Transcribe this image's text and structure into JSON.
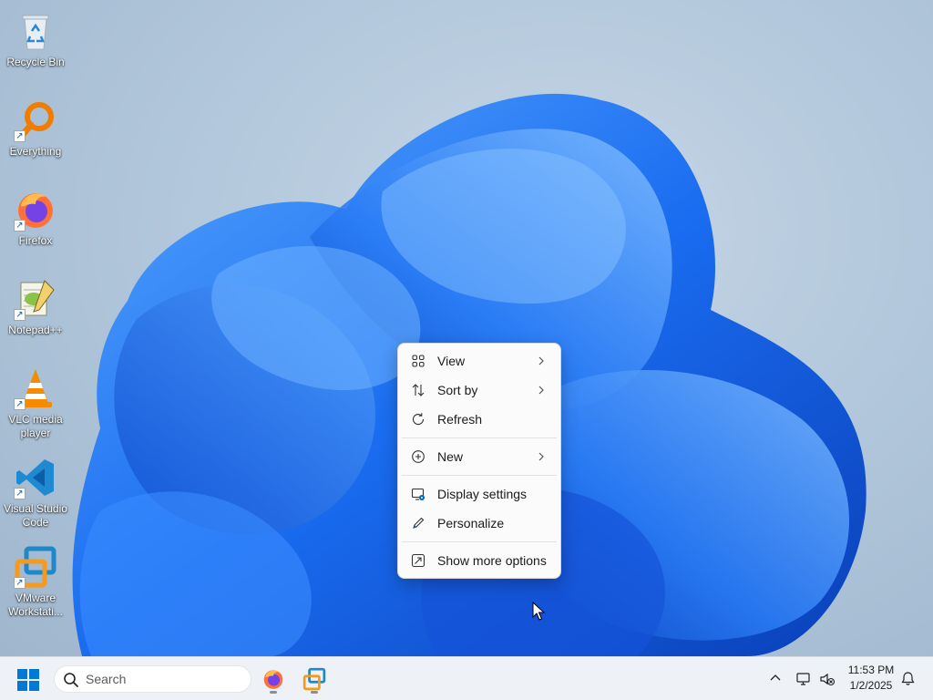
{
  "desktop": {
    "icons": [
      {
        "label": "Recycle Bin",
        "icon": "recycle-bin-icon"
      },
      {
        "label": "Everything",
        "icon": "everything-search-icon"
      },
      {
        "label": "Firefox",
        "icon": "firefox-icon"
      },
      {
        "label": "Notepad++",
        "icon": "notepad-plus-plus-icon"
      },
      {
        "label": "VLC media player",
        "icon": "vlc-cone-icon"
      },
      {
        "label": "Visual Studio Code",
        "icon": "vscode-icon"
      },
      {
        "label": "VMware Workstati...",
        "icon": "vmware-workstation-icon"
      }
    ]
  },
  "context_menu": {
    "items": [
      {
        "label": "View",
        "icon": "view-grid-icon",
        "submenu": true
      },
      {
        "label": "Sort by",
        "icon": "sort-arrows-icon",
        "submenu": true
      },
      {
        "label": "Refresh",
        "icon": "refresh-icon",
        "submenu": false
      },
      {
        "label": "New",
        "icon": "plus-circle-icon",
        "submenu": true
      },
      {
        "label": "Display settings",
        "icon": "display-settings-icon",
        "submenu": false
      },
      {
        "label": "Personalize",
        "icon": "pencil-icon",
        "submenu": false
      },
      {
        "label": "Show more options",
        "icon": "show-more-options-icon",
        "submenu": false
      }
    ]
  },
  "taskbar": {
    "search_placeholder": "Search",
    "pinned_apps": [
      {
        "icon": "firefox-icon",
        "running": true
      },
      {
        "icon": "vmware-workstation-icon",
        "running": true
      }
    ],
    "clock_time": "11:53 PM",
    "clock_date": "1/2/2025"
  },
  "colors": {
    "accent": "#0067c0",
    "wallpaper_bloom": "#1a6cf0",
    "taskbar_bg": "#eef2f6",
    "menu_bg": "#fbfbfb"
  }
}
